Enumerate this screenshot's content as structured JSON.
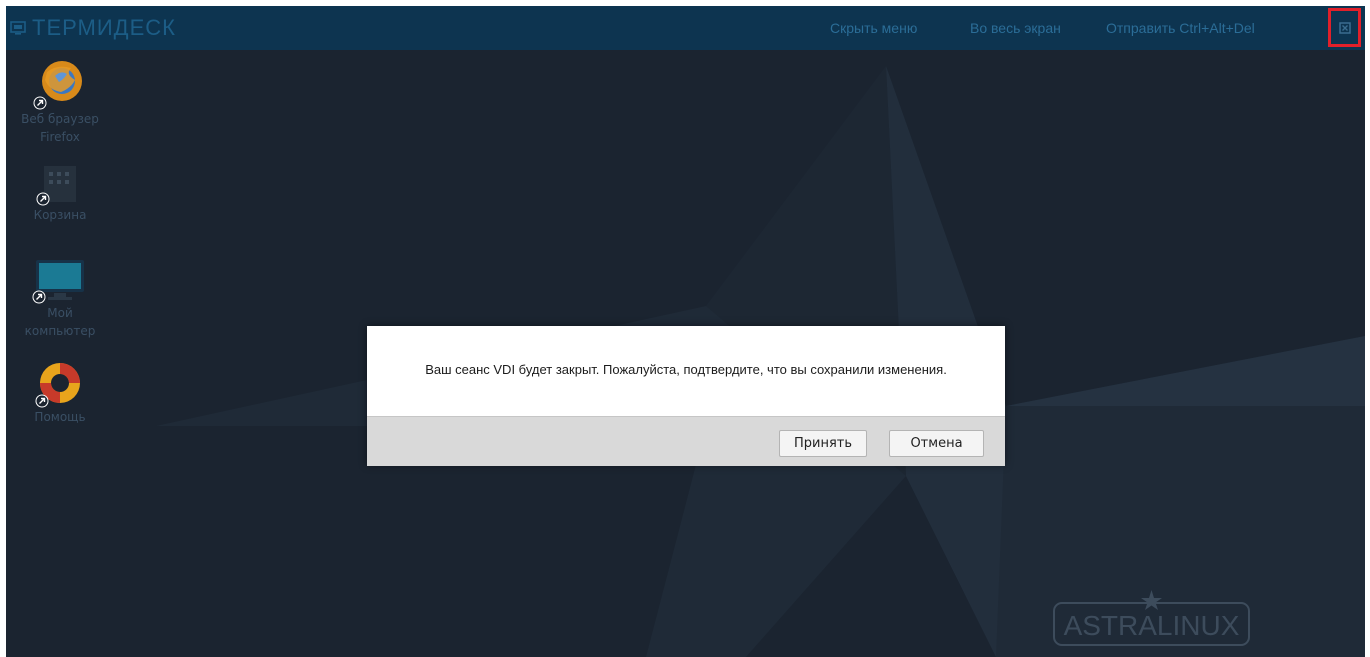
{
  "app": {
    "logo_text": "ТЕРМИДЕСК",
    "logo_icon": "monitor-icon"
  },
  "topbar": {
    "hide_menu": "Скрыть меню",
    "fullscreen": "Во весь экран",
    "send_cad": "Отправить Ctrl+Alt+Del",
    "close_icon": "close-icon"
  },
  "desktop": {
    "icons": [
      {
        "label_line1": "Веб браузер",
        "label_line2": "Firefox",
        "icon": "firefox-icon"
      },
      {
        "label_line1": "Корзина",
        "label_line2": "",
        "icon": "trash-icon"
      },
      {
        "label_line1": "Мой",
        "label_line2": "компьютер",
        "icon": "computer-icon"
      },
      {
        "label_line1": "Помощь",
        "label_line2": "",
        "icon": "help-icon"
      }
    ],
    "watermark": "ASTRALINUX"
  },
  "dialog": {
    "message": "Ваш сеанс VDI будет закрыт. Пожалуйста, подтвердите, что вы сохранили изменения.",
    "accept_label": "Принять",
    "cancel_label": "Отмена"
  },
  "colors": {
    "desktop_bg": "#1b2430",
    "topbar_bg": "#0d3450",
    "topbar_text": "#2b6d97",
    "close_highlight": "#e0202a"
  }
}
